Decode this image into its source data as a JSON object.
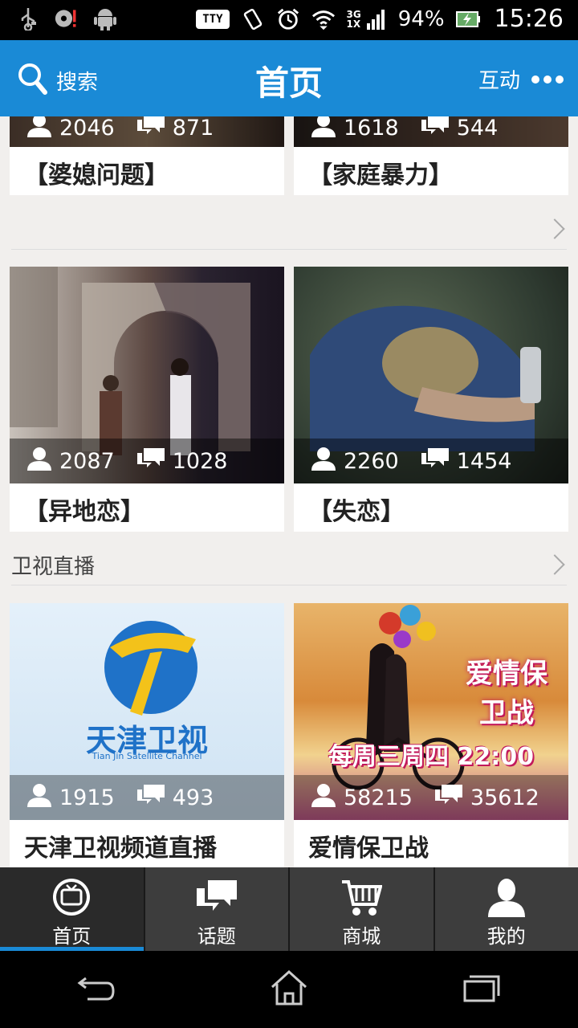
{
  "status_bar": {
    "tty": "TTY",
    "net_top": "3G",
    "net_bottom": "1X",
    "battery": "94%",
    "time": "15:26"
  },
  "app_bar": {
    "search_label": "搜索",
    "title": "首页",
    "interact_label": "互动"
  },
  "cards_row1": [
    {
      "views": "2046",
      "comments": "871",
      "label": "【婆媳问题】"
    },
    {
      "views": "1618",
      "comments": "544",
      "label": "【家庭暴力】"
    }
  ],
  "cards_row2": [
    {
      "views": "2087",
      "comments": "1028",
      "label": "【异地恋】"
    },
    {
      "views": "2260",
      "comments": "1454",
      "label": "【失恋】"
    }
  ],
  "section_tv": {
    "title": "卫视直播"
  },
  "cards_row3": [
    {
      "views": "1915",
      "comments": "493",
      "label": "天津卫视频道直播",
      "logo_text": "天津卫视",
      "logo_sub": "Tian Jin Satellite Channel"
    },
    {
      "views": "58215",
      "comments": "35612",
      "label": "爱情保卫战",
      "poster_text": "每周三周四 22:00",
      "poster_title": "爱情保卫战"
    }
  ],
  "tabs": [
    {
      "label": "首页",
      "icon": "tv-icon",
      "active": true
    },
    {
      "label": "话题",
      "icon": "chat-icon",
      "active": false
    },
    {
      "label": "商城",
      "icon": "cart-icon",
      "active": false
    },
    {
      "label": "我的",
      "icon": "person-icon",
      "active": false
    }
  ],
  "colors": {
    "accent": "#1a8ad6",
    "background": "#f1efed"
  }
}
